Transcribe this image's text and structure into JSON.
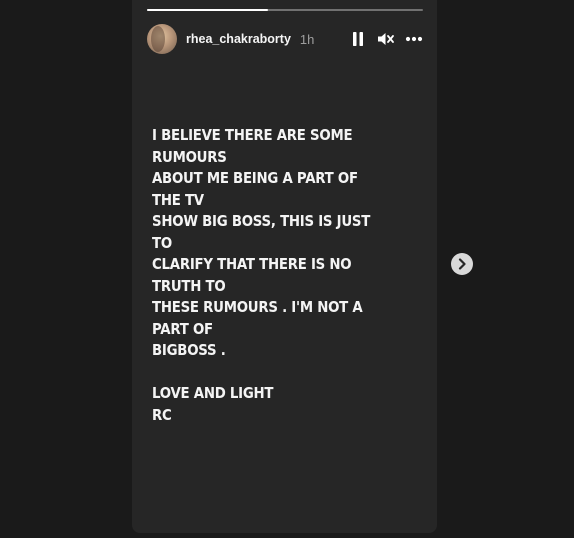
{
  "story": {
    "progress": 0.44,
    "username": "rhea_chakraborty",
    "timestamp": "1h",
    "text": "I BELIEVE THERE ARE SOME RUMOURS\nABOUT ME BEING A PART OF THE TV\nSHOW BIG BOSS, THIS IS JUST TO\nCLARIFY THAT THERE IS NO TRUTH TO\nTHESE RUMOURS . I'M NOT A PART OF\nBIGBOSS .\n\nLOVE AND LIGHT\nRC"
  },
  "controls": {
    "pause_icon": "pause-icon",
    "mute_icon": "muted-speaker-icon",
    "more_icon": "more-horizontal-icon"
  },
  "navigation": {
    "next_icon": "chevron-right-icon"
  },
  "colors": {
    "page_background": "#1a1a1a",
    "story_background": "#262626",
    "text": "#f4f4f4"
  }
}
